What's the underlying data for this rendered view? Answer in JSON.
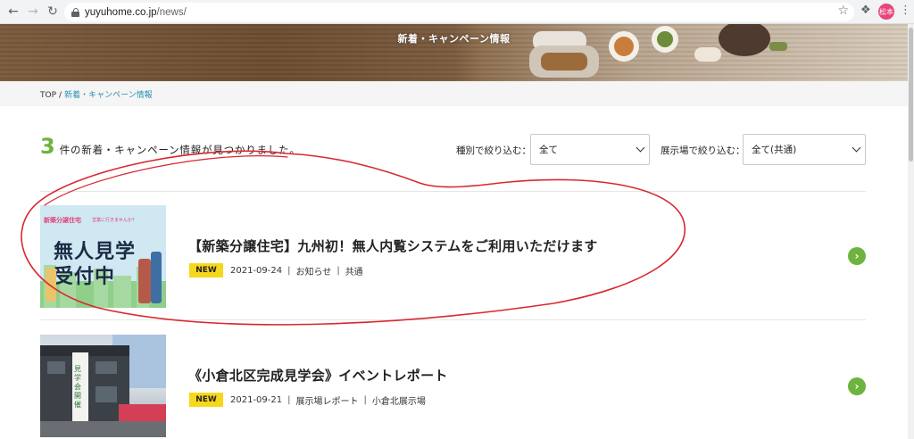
{
  "browser": {
    "url_host": "yuyuhome.co.jp",
    "url_path": "/news/",
    "profile_initials": "松本"
  },
  "hero": {
    "title": "新着・キャンペーン情報"
  },
  "breadcrumb": {
    "home": "TOP",
    "separator": "/",
    "current": "新着・キャンペーン情報"
  },
  "results": {
    "count": "3",
    "text": "件の新着・キャンペーン情報が見つかりました。"
  },
  "filters": {
    "type_label": "種別で絞り込む：",
    "type_value": "全て",
    "venue_label": "展示場で絞り込む：",
    "venue_value": "全て(共通)"
  },
  "articles": [
    {
      "title": "【新築分譲住宅】九州初！無人内覧システムをご利用いただけます",
      "badge": "NEW",
      "date": "2021-09-24",
      "category": "お知らせ",
      "venue": "共通",
      "thumb_tag": "新築分譲住宅",
      "thumb_tag_small": "営業に行きませんか?",
      "thumb_line1": "無人見学",
      "thumb_line2": "受付中"
    },
    {
      "title": "《小倉北区完成見学会》イベントレポート",
      "badge": "NEW",
      "date": "2021-09-21",
      "category": "展示場レポート",
      "venue": "小倉北展示場",
      "thumb_banner": "見学会開催"
    }
  ],
  "colors": {
    "accent_green": "#6db33f",
    "badge_yellow": "#f7d71c",
    "link_blue": "#2b8fb5",
    "annotation_red": "#d8282f"
  },
  "icons": [
    "back-arrow-icon",
    "forward-arrow-icon",
    "reload-icon",
    "lock-icon",
    "star-icon",
    "extension-icon",
    "kebab-menu-icon",
    "chevron-down-icon",
    "chevron-right-icon"
  ]
}
